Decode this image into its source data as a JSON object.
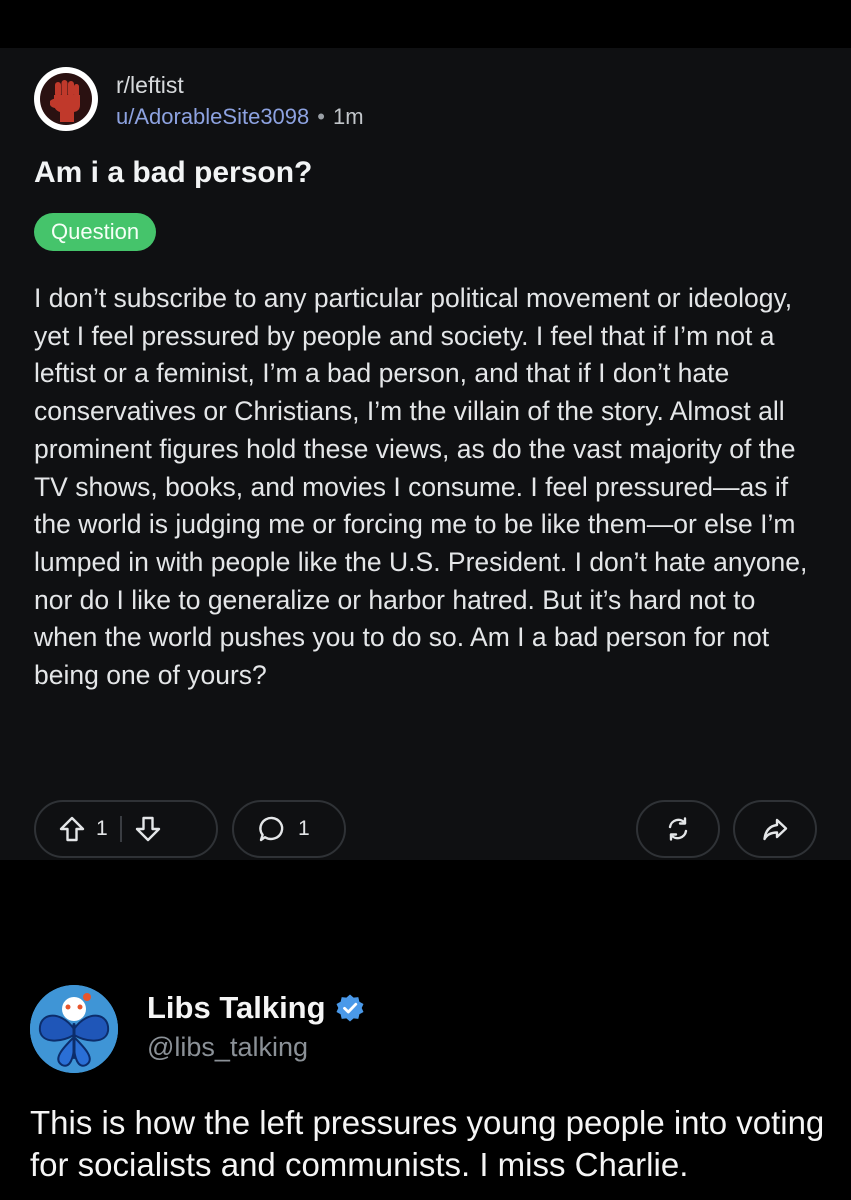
{
  "post": {
    "subreddit": "r/leftist",
    "username": "u/AdorableSite3098",
    "separator": "•",
    "time": "1m",
    "title": "Am i a bad person?",
    "flair": "Question",
    "body": "I don’t subscribe to any particular political movement or ideology, yet I feel pressured by people and society. I feel that if I’m not a leftist or a feminist, I’m a bad person, and that if I don’t hate conservatives or Christians, I’m the villain of the story. Almost all prominent figures hold these views, as do the vast majority of the TV shows, books, and movies I consume. I feel pressured—as if the world is judging me or forcing me to be like them—or else I’m lumped in with people like the U.S. President. I don’t hate anyone, nor do I like to generalize or harbor hatred. But it’s hard not to when the world pushes you to do so. Am I a bad person for not being one of yours?",
    "upvotes": "1",
    "comments": "1",
    "colors": {
      "flair": "#45c46b",
      "username": "#8da2e0",
      "card": "#0f1012"
    },
    "icons": [
      "upvote-icon",
      "downvote-icon",
      "comment-icon",
      "crosspost-icon",
      "share-icon"
    ]
  },
  "tweet": {
    "display_name": "Libs Talking",
    "handle": "@libs_talking",
    "text": "This is how the left pressures young people into voting for socialists and communists. I miss Charlie.",
    "colors": {
      "verified": "#4a99e9"
    }
  }
}
